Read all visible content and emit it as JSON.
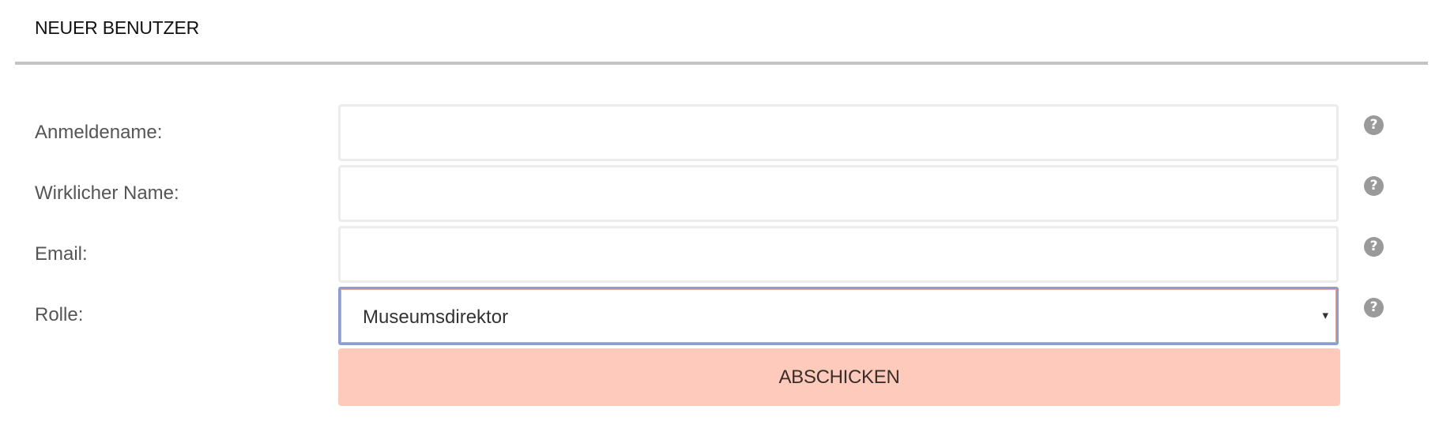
{
  "header": {
    "title": "NEUER BENUTZER"
  },
  "form": {
    "fields": [
      {
        "label": "Anmeldename:",
        "value": ""
      },
      {
        "label": "Wirklicher Name:",
        "value": ""
      },
      {
        "label": "Email:",
        "value": ""
      },
      {
        "label": "Rolle:",
        "value": "Museumsdirektor"
      }
    ],
    "help_glyph": "?",
    "select_arrow_glyph": "▾",
    "submit_label": "ABSCHICKEN"
  },
  "icons": {
    "help": "question-circle-icon",
    "select_arrow": "caret-down-icon"
  },
  "colors": {
    "submit_background": "#fecabb",
    "help_icon": "#9a9a9a",
    "divider": "#c4c4c4",
    "select_focus_border": "#8f9ed2"
  }
}
